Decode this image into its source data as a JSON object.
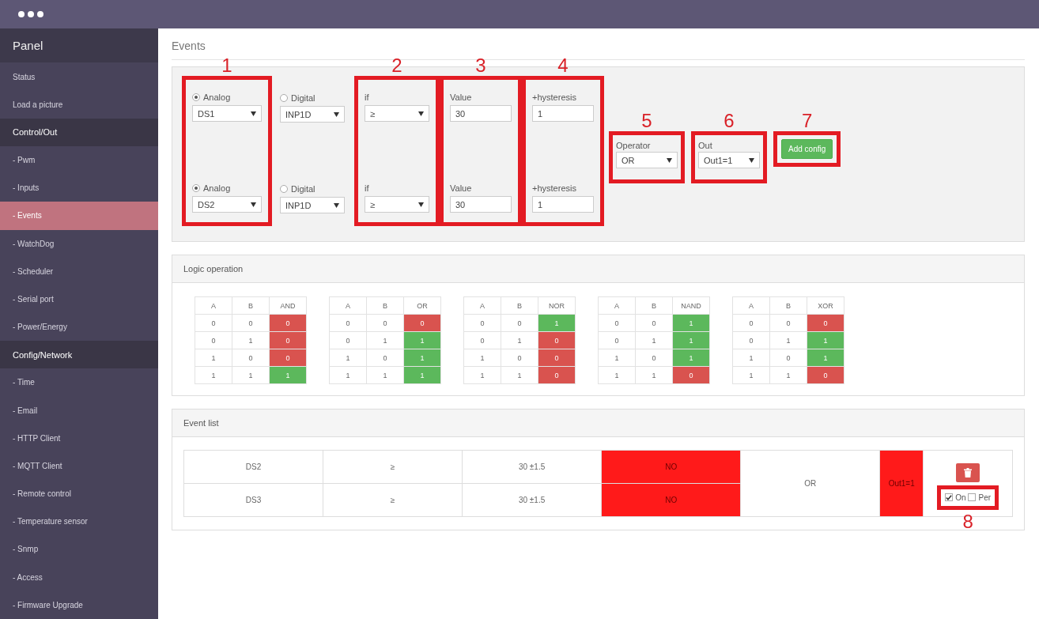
{
  "sidebar": {
    "title": "Panel",
    "items": [
      {
        "label": "Status",
        "kind": "item",
        "selected": false
      },
      {
        "label": "Load a picture",
        "kind": "item",
        "selected": false
      },
      {
        "label": "Control/Out",
        "kind": "section",
        "selected": false
      },
      {
        "label": "- Pwm",
        "kind": "item",
        "selected": false
      },
      {
        "label": "- Inputs",
        "kind": "item",
        "selected": false
      },
      {
        "label": "- Events",
        "kind": "item",
        "selected": true
      },
      {
        "label": "- WatchDog",
        "kind": "item",
        "selected": false
      },
      {
        "label": "- Scheduler",
        "kind": "item",
        "selected": false
      },
      {
        "label": "- Serial port",
        "kind": "item",
        "selected": false
      },
      {
        "label": "- Power/Energy",
        "kind": "item",
        "selected": false
      },
      {
        "label": "Config/Network",
        "kind": "section",
        "selected": false
      },
      {
        "label": "- Time",
        "kind": "item",
        "selected": false
      },
      {
        "label": "- Email",
        "kind": "item",
        "selected": false
      },
      {
        "label": "- HTTP Client",
        "kind": "item",
        "selected": false
      },
      {
        "label": "- MQTT Client",
        "kind": "item",
        "selected": false
      },
      {
        "label": "- Remote control",
        "kind": "item",
        "selected": false
      },
      {
        "label": "- Temperature sensor",
        "kind": "item",
        "selected": false
      },
      {
        "label": "- Snmp",
        "kind": "item",
        "selected": false
      },
      {
        "label": "- Access",
        "kind": "item",
        "selected": false
      },
      {
        "label": "- Firmware Upgrade",
        "kind": "item",
        "selected": false
      }
    ]
  },
  "page_title": "Events",
  "config": {
    "callouts": {
      "source": "1",
      "condition": "2",
      "value": "3",
      "hysteresis": "4",
      "operator": "5",
      "out": "6",
      "add": "7"
    },
    "rows": [
      {
        "analog": {
          "label": "Analog",
          "selected": true,
          "value": "DS1"
        },
        "digital": {
          "label": "Digital",
          "selected": false,
          "value": "INP1D"
        },
        "condition": {
          "label": "if",
          "value": "≥"
        },
        "value": {
          "label": "Value",
          "value": "30"
        },
        "hysteresis": {
          "label": "+hysteresis",
          "value": "1"
        }
      },
      {
        "analog": {
          "label": "Analog",
          "selected": true,
          "value": "DS2"
        },
        "digital": {
          "label": "Digital",
          "selected": false,
          "value": "INP1D"
        },
        "condition": {
          "label": "if",
          "value": "≥"
        },
        "value": {
          "label": "Value",
          "value": "30"
        },
        "hysteresis": {
          "label": "+hysteresis",
          "value": "1"
        }
      }
    ],
    "operator": {
      "label": "Operator",
      "value": "OR"
    },
    "out": {
      "label": "Out",
      "value": "Out1=1"
    },
    "add_button": "Add config"
  },
  "logic": {
    "title": "Logic operation",
    "tables": [
      {
        "headers": [
          "A",
          "B",
          "AND"
        ],
        "rows": [
          {
            "a": "0",
            "b": "0",
            "result": "0",
            "on": false
          },
          {
            "a": "0",
            "b": "1",
            "result": "0",
            "on": false
          },
          {
            "a": "1",
            "b": "0",
            "result": "0",
            "on": false
          },
          {
            "a": "1",
            "b": "1",
            "result": "1",
            "on": true
          }
        ]
      },
      {
        "headers": [
          "A",
          "B",
          "OR"
        ],
        "rows": [
          {
            "a": "0",
            "b": "0",
            "result": "0",
            "on": false
          },
          {
            "a": "0",
            "b": "1",
            "result": "1",
            "on": true
          },
          {
            "a": "1",
            "b": "0",
            "result": "1",
            "on": true
          },
          {
            "a": "1",
            "b": "1",
            "result": "1",
            "on": true
          }
        ]
      },
      {
        "headers": [
          "A",
          "B",
          "NOR"
        ],
        "rows": [
          {
            "a": "0",
            "b": "0",
            "result": "1",
            "on": true
          },
          {
            "a": "0",
            "b": "1",
            "result": "0",
            "on": false
          },
          {
            "a": "1",
            "b": "0",
            "result": "0",
            "on": false
          },
          {
            "a": "1",
            "b": "1",
            "result": "0",
            "on": false
          }
        ]
      },
      {
        "headers": [
          "A",
          "B",
          "NAND"
        ],
        "rows": [
          {
            "a": "0",
            "b": "0",
            "result": "1",
            "on": true
          },
          {
            "a": "0",
            "b": "1",
            "result": "1",
            "on": true
          },
          {
            "a": "1",
            "b": "0",
            "result": "1",
            "on": true
          },
          {
            "a": "1",
            "b": "1",
            "result": "0",
            "on": false
          }
        ]
      },
      {
        "headers": [
          "A",
          "B",
          "XOR"
        ],
        "rows": [
          {
            "a": "0",
            "b": "0",
            "result": "0",
            "on": false
          },
          {
            "a": "0",
            "b": "1",
            "result": "1",
            "on": true
          },
          {
            "a": "1",
            "b": "0",
            "result": "1",
            "on": true
          },
          {
            "a": "1",
            "b": "1",
            "result": "0",
            "on": false
          }
        ]
      }
    ]
  },
  "event_list": {
    "title": "Event list",
    "rows": [
      {
        "source": "DS2",
        "condition": "≥",
        "value": "30 ±1.5",
        "state": "NO",
        "on": false
      },
      {
        "source": "DS3",
        "condition": "≥",
        "value": "30 ±1.5",
        "state": "NO",
        "on": false
      }
    ],
    "operator": "OR",
    "out": {
      "label": "Out1=1",
      "on": false
    },
    "callout": "8",
    "enabled": {
      "label": "On",
      "checked": true
    },
    "periodic": {
      "label": "Per",
      "checked": false
    }
  }
}
